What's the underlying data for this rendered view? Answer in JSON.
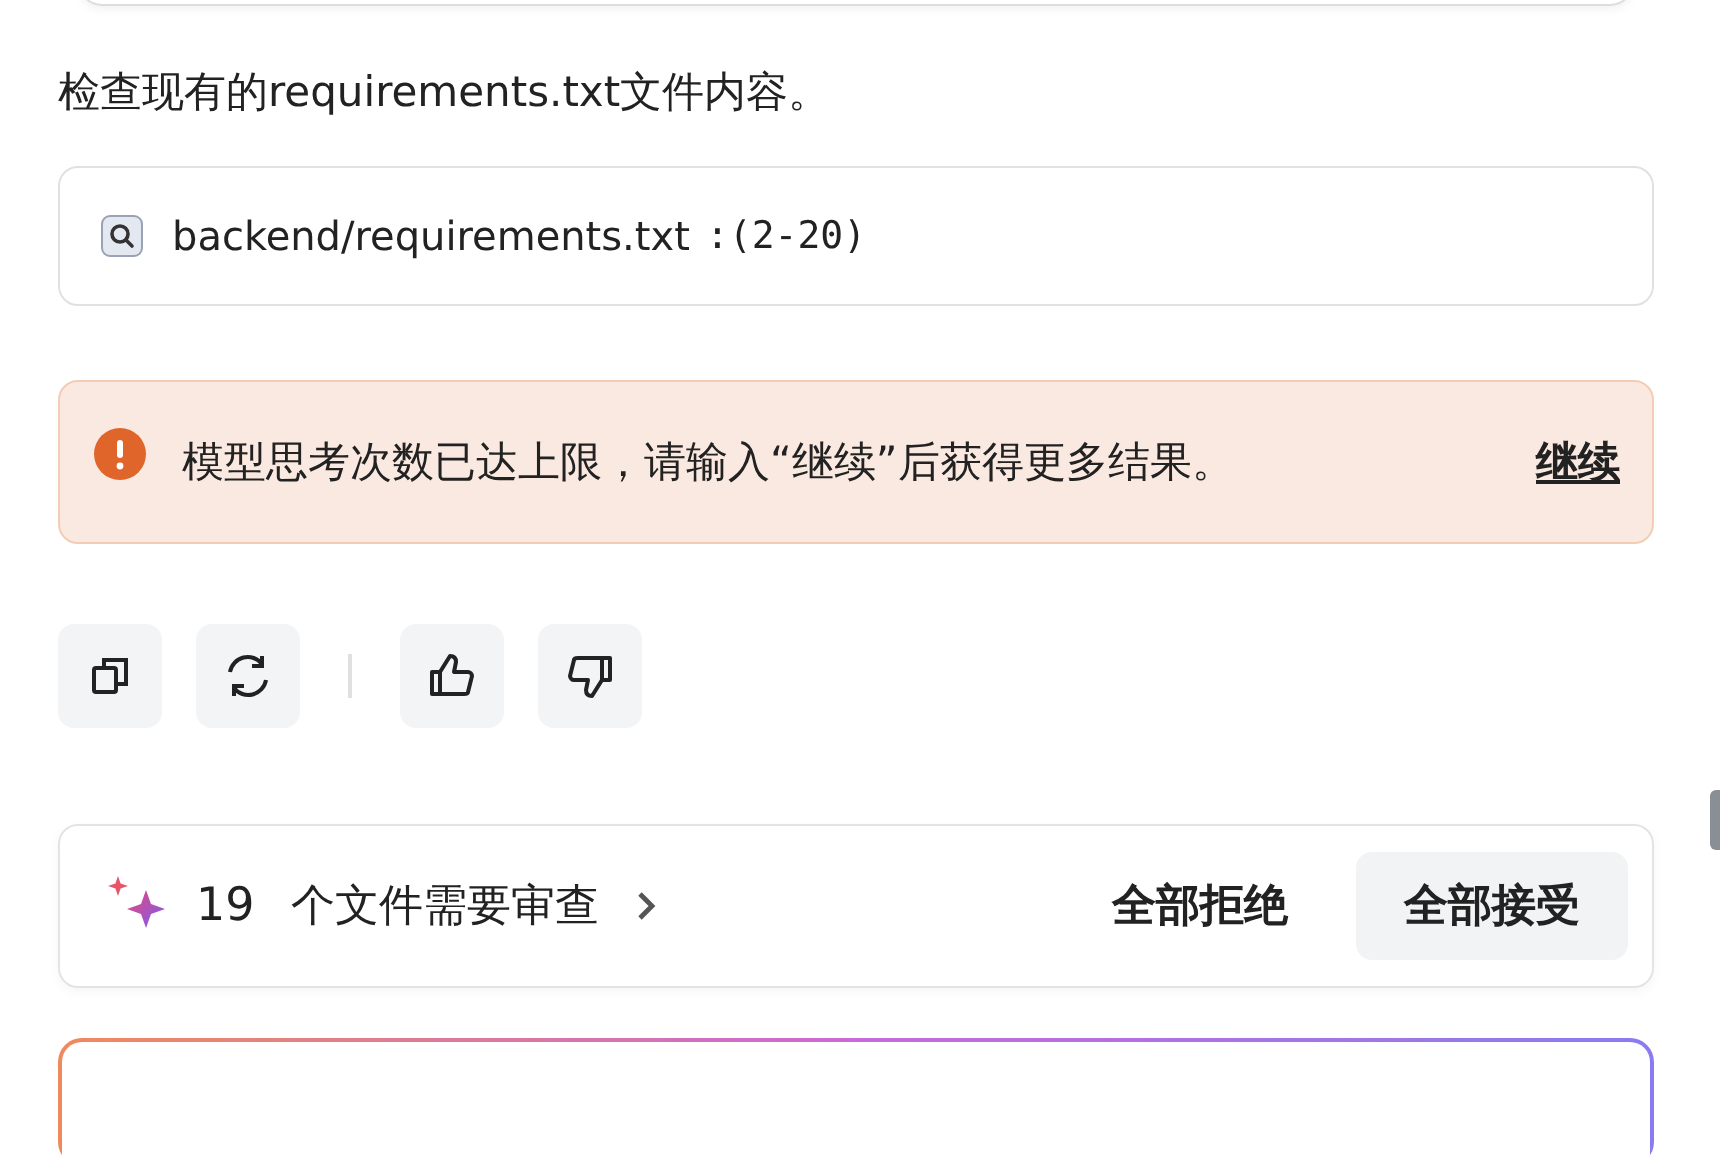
{
  "message": {
    "text": "检查现有的requirements.txt文件内容。"
  },
  "tool_call": {
    "path": "backend/requirements.txt",
    "range": ":(2-20)"
  },
  "alert": {
    "text": "模型思考次数已达上限，请输入“继续”后获得更多结果。",
    "link": "继续"
  },
  "actions": [
    {
      "kind": "copy"
    },
    {
      "kind": "refresh"
    },
    {
      "kind": "divider"
    },
    {
      "kind": "like"
    },
    {
      "kind": "dislike"
    }
  ],
  "review": {
    "count": "19",
    "label": "个文件需要审查",
    "buttons": [
      {
        "label": "全部拒绝",
        "kind": "plain"
      },
      {
        "label": "全部接受",
        "kind": "filled"
      }
    ]
  }
}
